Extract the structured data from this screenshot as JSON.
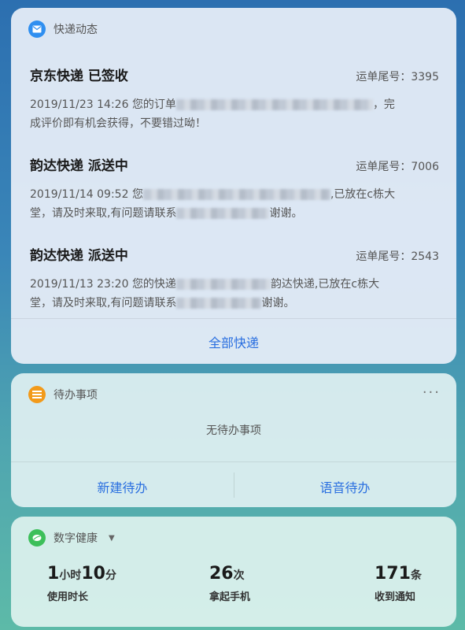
{
  "express": {
    "title": "快递动态",
    "icon": "mail-icon",
    "parcels": [
      {
        "title": "京东快递 已签收",
        "track": "运单尾号：3395",
        "line1_prefix": "2019/11/23 14:26  您的订单",
        "line1_suffix": "，完",
        "line2": "成评价即有机会获得，不要错过呦！"
      },
      {
        "title": "韵达快递 派送中",
        "track": "运单尾号：7006",
        "line1_prefix": "2019/11/14 09:52  您",
        "line1_suffix": ",已放在c栋大",
        "line2_prefix": "堂，请及时来取,有问题请联系",
        "line2_suffix": "谢谢。"
      },
      {
        "title": "韵达快递 派送中",
        "track": "运单尾号：2543",
        "line1_prefix": "2019/11/13 23:20  您的快递",
        "line1_suffix": "韵达快递,已放在c栋大",
        "line2_prefix": "堂，请及时来取,有问题请联系",
        "line2_suffix": "谢谢。"
      }
    ],
    "all_button": "全部快递"
  },
  "todo": {
    "title": "待办事项",
    "icon": "list-icon",
    "more": "···",
    "empty": "无待办事项",
    "new_button": "新建待办",
    "voice_button": "语音待办"
  },
  "health": {
    "title": "数字健康",
    "icon": "leaf-icon",
    "stats": [
      {
        "v1": "1",
        "u1": "小时",
        "v2": "10",
        "u2": "分",
        "label": "使用时长"
      },
      {
        "v1": "26",
        "u1": "次",
        "label": "拿起手机"
      },
      {
        "v1": "171",
        "u1": "条",
        "label": "收到通知"
      }
    ]
  },
  "colors": {
    "accent": "#2a6fe0",
    "express_icon": "#2f8ff0",
    "todo_icon": "#f29a1a",
    "health_icon": "#3cbf5a"
  }
}
